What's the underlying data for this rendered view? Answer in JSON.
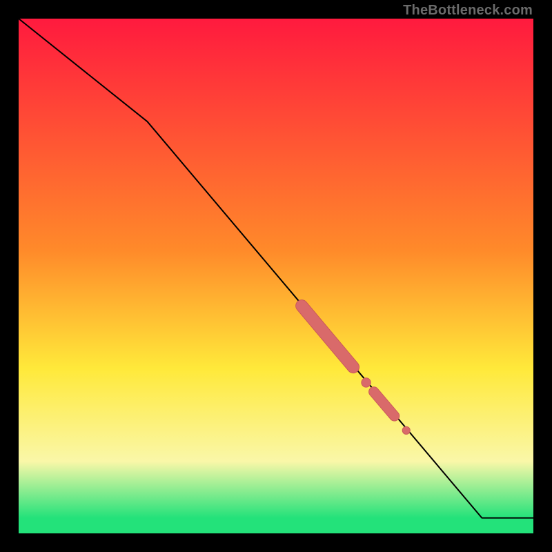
{
  "watermark": "TheBottleneck.com",
  "colors": {
    "black": "#000000",
    "red_top": "#ff1a3e",
    "orange": "#ff8a2a",
    "yellow": "#ffe93a",
    "pale_yellow": "#faf7a8",
    "green": "#23e27a",
    "line": "#000000",
    "marker": "#d96a6a",
    "marker_edge": "#c95858"
  },
  "chart_data": {
    "type": "line",
    "title": "",
    "xlabel": "",
    "ylabel": "",
    "xlim": [
      0,
      100
    ],
    "ylim": [
      0,
      100
    ],
    "gradient_stops": [
      {
        "y": 0,
        "color": "#ff1a3e"
      },
      {
        "y": 45,
        "color": "#ff8a2a"
      },
      {
        "y": 68,
        "color": "#ffe93a"
      },
      {
        "y": 86,
        "color": "#faf7a8"
      },
      {
        "y": 97,
        "color": "#23e27a"
      },
      {
        "y": 100,
        "color": "#23e27a"
      }
    ],
    "series": [
      {
        "name": "bottleneck-curve",
        "x": [
          0,
          25,
          90,
          100
        ],
        "y": [
          100,
          80,
          3,
          3
        ]
      }
    ],
    "markers": [
      {
        "name": "highlight-segment-1",
        "shape": "capsule",
        "x0": 55,
        "y0": 44.2,
        "x1": 65,
        "y1": 32.3,
        "thickness": 2.2
      },
      {
        "name": "highlight-dot-1",
        "shape": "dot",
        "x": 67.5,
        "y": 29.3,
        "r": 0.9
      },
      {
        "name": "highlight-segment-2",
        "shape": "capsule",
        "x0": 69,
        "y0": 27.5,
        "x1": 73,
        "y1": 22.8,
        "thickness": 1.8
      },
      {
        "name": "highlight-dot-2",
        "shape": "dot",
        "x": 75.3,
        "y": 20.0,
        "r": 0.75
      }
    ]
  }
}
